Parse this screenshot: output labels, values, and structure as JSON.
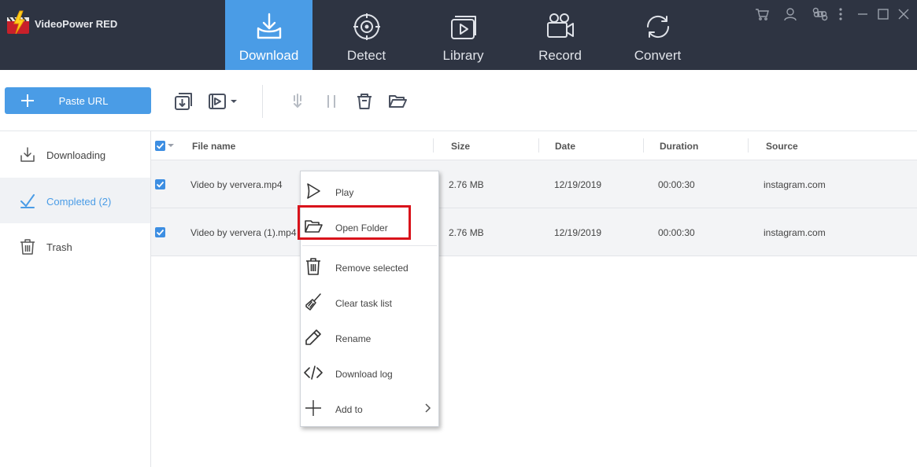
{
  "app": {
    "title": "VideoPower RED"
  },
  "nav": {
    "tabs": [
      {
        "label": "Download",
        "icon": "download-tray-icon",
        "active": true
      },
      {
        "label": "Detect",
        "icon": "target-icon",
        "active": false
      },
      {
        "label": "Library",
        "icon": "video-library-icon",
        "active": false
      },
      {
        "label": "Record",
        "icon": "camera-icon",
        "active": false
      },
      {
        "label": "Convert",
        "icon": "convert-arrows-icon",
        "active": false
      }
    ]
  },
  "window_controls": [
    "cart-icon",
    "user-icon",
    "command-icon",
    "more-icon",
    "minimize-icon",
    "maximize-icon",
    "close-icon"
  ],
  "toolbar": {
    "paste_url": "Paste URL"
  },
  "sidebar": {
    "items": [
      {
        "label": "Downloading",
        "icon": "download-icon",
        "active": false
      },
      {
        "label": "Completed (2)",
        "icon": "check-icon",
        "active": true
      },
      {
        "label": "Trash",
        "icon": "trash-icon",
        "active": false
      }
    ]
  },
  "table": {
    "columns": [
      "File name",
      "Size",
      "Date",
      "Duration",
      "Source"
    ],
    "rows": [
      {
        "checked": true,
        "file_name": "Video by ververa.mp4",
        "size": "2.76 MB",
        "date": "12/19/2019",
        "duration": "00:00:30",
        "source": "instagram.com"
      },
      {
        "checked": true,
        "file_name": "Video by ververa (1).mp4",
        "size": "2.76 MB",
        "date": "12/19/2019",
        "duration": "00:00:30",
        "source": "instagram.com"
      }
    ]
  },
  "context_menu": {
    "items": [
      {
        "label": "Play",
        "icon": "play-icon"
      },
      {
        "label": "Open Folder",
        "icon": "folder-open-icon",
        "highlighted": true
      },
      {
        "label": "Remove selected",
        "icon": "trash-icon"
      },
      {
        "label": "Clear task list",
        "icon": "broom-icon"
      },
      {
        "label": "Rename",
        "icon": "pencil-icon"
      },
      {
        "label": "Download log",
        "icon": "code-icon"
      },
      {
        "label": "Add to",
        "icon": "plus-icon",
        "submenu": true
      }
    ]
  },
  "colors": {
    "topbar_bg": "#2e3442",
    "accent": "#4a9ce6",
    "highlight_border": "#d9131b"
  }
}
